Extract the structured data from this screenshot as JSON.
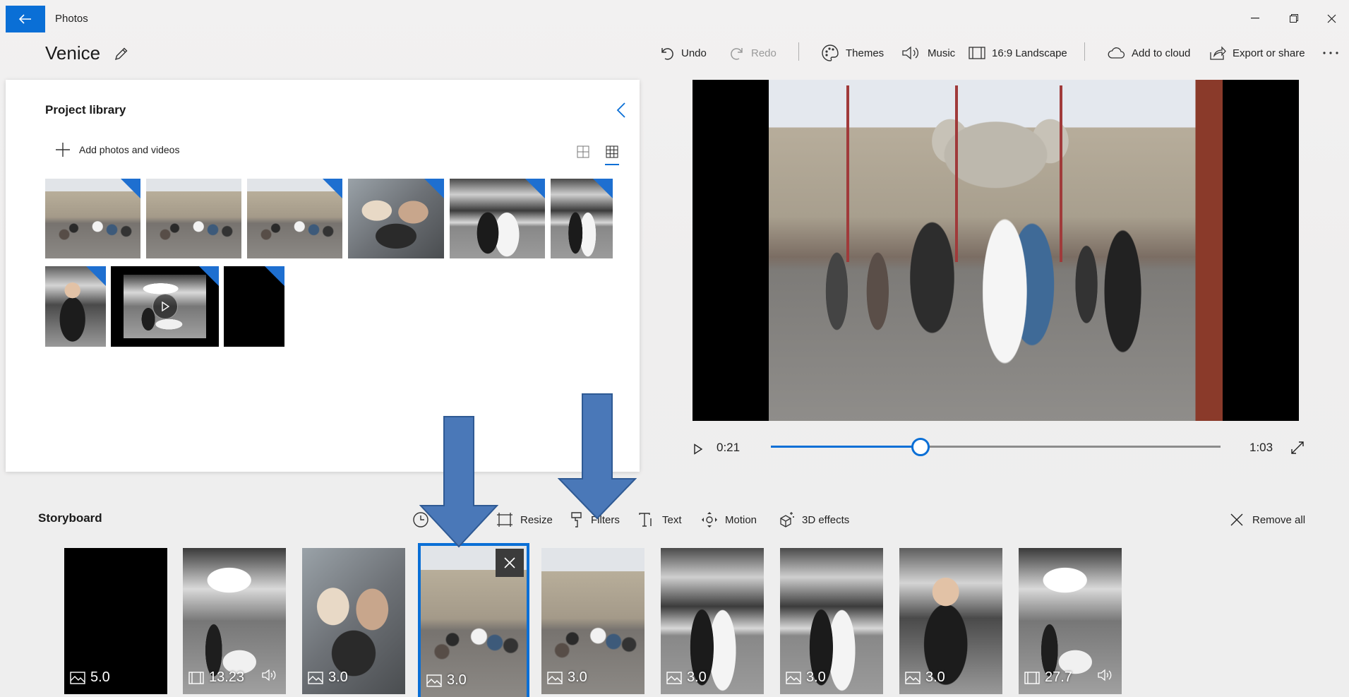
{
  "app": {
    "title": "Photos"
  },
  "project": {
    "name": "Venice"
  },
  "toolbar": {
    "undo": "Undo",
    "redo": "Redo",
    "themes": "Themes",
    "music": "Music",
    "aspect": "16:9 Landscape",
    "add_to_cloud": "Add to cloud",
    "export": "Export or share"
  },
  "library": {
    "title": "Project library",
    "add_label": "Add photos and videos",
    "items": [
      {
        "scene": "basilica-crowd",
        "unused": true
      },
      {
        "scene": "basilica-crowd",
        "unused": false
      },
      {
        "scene": "basilica-crowd",
        "unused": true
      },
      {
        "scene": "pigeons",
        "unused": true
      },
      {
        "scene": "arcade-couple",
        "unused": true
      },
      {
        "scene": "arcade-couple",
        "unused": true
      },
      {
        "scene": "man-shouting",
        "unused": true
      },
      {
        "scene": "cafe-video",
        "unused": true,
        "video": true
      },
      {
        "scene": "black",
        "unused": true
      }
    ]
  },
  "player": {
    "current_time": "0:21",
    "total_time": "1:03",
    "progress": 0.3333
  },
  "storyboard": {
    "title": "Storyboard",
    "tools": {
      "duration": "D",
      "resize": "Resize",
      "filters": "Filters",
      "text": "Text",
      "motion": "Motion",
      "effects_3d": "3D effects"
    },
    "remove_all": "Remove all",
    "cards": [
      {
        "type": "photo",
        "duration": "5.0",
        "scene": "black"
      },
      {
        "type": "video",
        "duration": "13.23",
        "scene": "cafe",
        "audio": true
      },
      {
        "type": "photo",
        "duration": "3.0",
        "scene": "pigeons"
      },
      {
        "type": "photo",
        "duration": "3.0",
        "scene": "basilica-crowd",
        "selected": true
      },
      {
        "type": "photo",
        "duration": "3.0",
        "scene": "basilica-crowd"
      },
      {
        "type": "photo",
        "duration": "3.0",
        "scene": "arcade-couple"
      },
      {
        "type": "photo",
        "duration": "3.0",
        "scene": "arcade-couple"
      },
      {
        "type": "photo",
        "duration": "3.0",
        "scene": "man-shouting"
      },
      {
        "type": "video",
        "duration": "27.7",
        "scene": "cafe",
        "audio": true
      }
    ]
  },
  "colors": {
    "accent": "#0a6fd6",
    "annotation_arrow": "#4a78b8",
    "unused_corner": "#1e6fd0"
  },
  "icons": {
    "back": "back-arrow-icon",
    "edit": "pencil-icon",
    "undo": "undo-icon",
    "redo": "redo-icon",
    "themes": "palette-icon",
    "music": "speaker-icon",
    "aspect": "aspect-ratio-icon",
    "cloud": "cloud-icon",
    "export": "share-icon",
    "more": "more-icon"
  }
}
